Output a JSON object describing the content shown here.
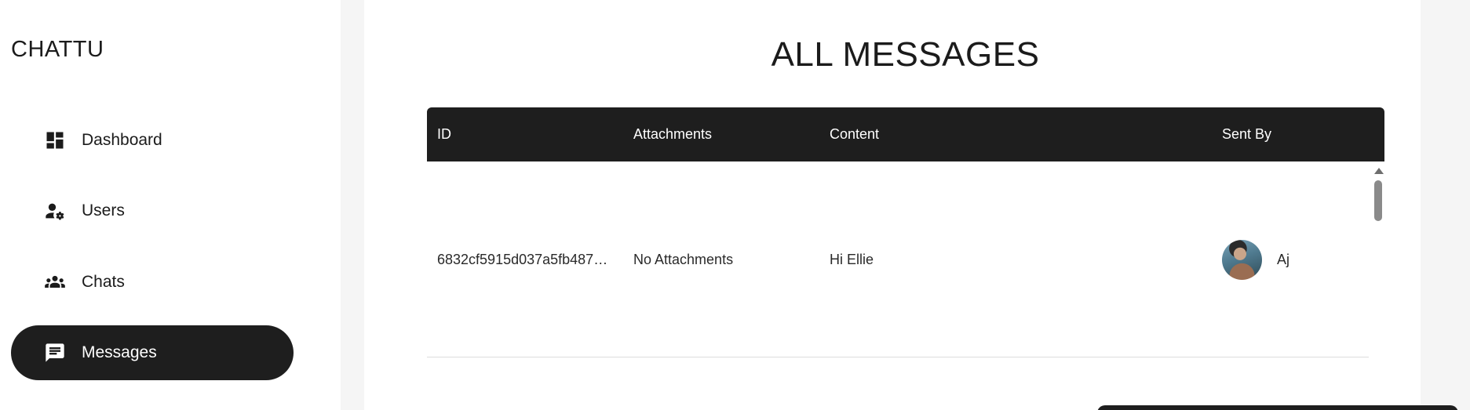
{
  "app": {
    "brand": "CHATTU"
  },
  "sidebar": {
    "items": [
      {
        "label": "Dashboard",
        "icon": "dashboard-icon",
        "active": false
      },
      {
        "label": "Users",
        "icon": "manage-accounts-icon",
        "active": false
      },
      {
        "label": "Chats",
        "icon": "groups-icon",
        "active": false
      },
      {
        "label": "Messages",
        "icon": "message-icon",
        "active": true
      }
    ]
  },
  "main": {
    "title": "ALL MESSAGES",
    "table": {
      "columns": [
        "ID",
        "Attachments",
        "Content",
        "Sent By"
      ],
      "rows": [
        {
          "id": "6832cf5915d037a5fb487…",
          "attachments": "No Attachments",
          "content": "Hi Ellie",
          "sent_by": "Aj"
        }
      ]
    }
  },
  "colors": {
    "accent": "#1e1e1e",
    "page_bg": "#f5f5f5",
    "text": "#1b1b1b"
  }
}
